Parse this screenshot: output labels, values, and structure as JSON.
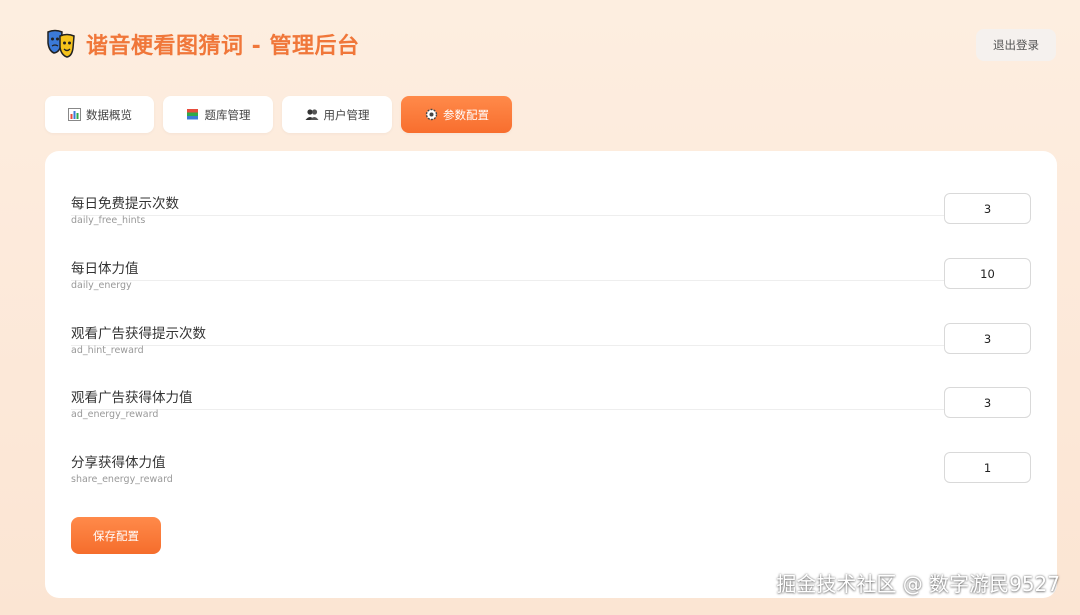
{
  "header": {
    "title": "谐音梗看图猜词 - 管理后台",
    "logo_icon": "theater-masks-icon",
    "logout_label": "退出登录"
  },
  "tabs": [
    {
      "label": "数据概览",
      "icon": "bar-chart-icon",
      "active": false
    },
    {
      "label": "题库管理",
      "icon": "books-icon",
      "active": false
    },
    {
      "label": "用户管理",
      "icon": "users-icon",
      "active": false
    },
    {
      "label": "参数配置",
      "icon": "gear-icon",
      "active": true
    }
  ],
  "config": {
    "items": [
      {
        "label": "每日免费提示次数",
        "key": "daily_free_hints",
        "value": "3"
      },
      {
        "label": "每日体力值",
        "key": "daily_energy",
        "value": "10"
      },
      {
        "label": "观看广告获得提示次数",
        "key": "ad_hint_reward",
        "value": "3"
      },
      {
        "label": "观看广告获得体力值",
        "key": "ad_energy_reward",
        "value": "3"
      },
      {
        "label": "分享获得体力值",
        "key": "share_energy_reward",
        "value": "1"
      }
    ],
    "save_label": "保存配置"
  },
  "watermark": "掘金技术社区 @ 数字游民9527",
  "colors": {
    "accent": "#f0773a",
    "accent_button": "#f86e2e",
    "background": "#fdeee0"
  }
}
